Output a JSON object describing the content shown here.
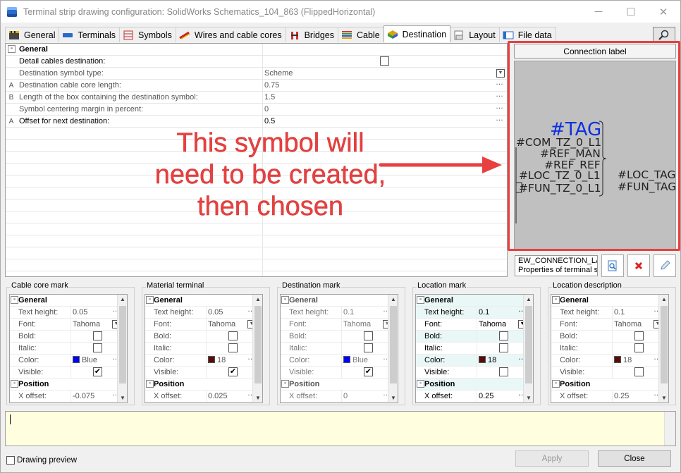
{
  "window": {
    "title": "Terminal strip drawing configuration: SolidWorks Schematics_104_863 (FlippedHorizontal)",
    "controls": {
      "minimize": "─",
      "maximize": "☐",
      "close": "✕"
    }
  },
  "tabs": [
    {
      "label": "General",
      "icon": "clapperboard-icon"
    },
    {
      "label": "Terminals",
      "icon": "terminal-icon"
    },
    {
      "label": "Symbols",
      "icon": "symbols-icon"
    },
    {
      "label": "Wires and cable cores",
      "icon": "wire-icon"
    },
    {
      "label": "Bridges",
      "icon": "bridge-icon"
    },
    {
      "label": "Cable",
      "icon": "cable-icon"
    },
    {
      "label": "Destination",
      "icon": "destination-icon",
      "active": true
    },
    {
      "label": "Layout",
      "icon": "layout-icon"
    },
    {
      "label": "File data",
      "icon": "file-data-icon"
    }
  ],
  "properties": {
    "section": "General",
    "rows": [
      {
        "flag": "",
        "name": "Detail cables destination:",
        "value": "",
        "type": "checkbox"
      },
      {
        "flag": "",
        "name": "Destination symbol type:",
        "value": "Scheme",
        "type": "dropdown"
      },
      {
        "flag": "A",
        "name": "Destination cable core length:",
        "value": "0.75",
        "type": "edit"
      },
      {
        "flag": "B",
        "name": "Length of the box containing the destination symbol:",
        "value": "1.5",
        "type": "edit"
      },
      {
        "flag": "",
        "name": "Symbol centering margin in percent:",
        "value": "0",
        "type": "edit"
      },
      {
        "flag": "A",
        "name": "Offset for next destination:",
        "value": "0.5",
        "type": "edit"
      }
    ]
  },
  "connection_label": {
    "header": "Connection label",
    "preview": {
      "tag": "#TAG",
      "lines": [
        "#COM_TZ_0_L1",
        "#REF_MAN",
        "#REF_REF",
        "#LOC_TZ_0_L1",
        "#FUN_TZ_0_L1"
      ],
      "right_lines": [
        "#LOC_TAG",
        "#FUN_TAG"
      ]
    },
    "list": [
      "EW_CONNECTION_LA",
      "Properties of terminal stri"
    ]
  },
  "annotation": "This symbol will need to be created, then chosen",
  "groups": [
    {
      "title": "Cable core mark",
      "text_height": "0.05",
      "font": "Tahoma",
      "color": "Blue",
      "color_hex": "#0000ff",
      "bold": false,
      "italic": false,
      "visible": true,
      "x_offset": "-0.075",
      "highlight": false
    },
    {
      "title": "Material terminal",
      "text_height": "0.05",
      "font": "Tahoma",
      "color": "18",
      "color_hex": "#5a0a0a",
      "bold": false,
      "italic": false,
      "visible": true,
      "x_offset": "0.025",
      "highlight": false
    },
    {
      "title": "Destination mark",
      "text_height": "0.1",
      "font": "Tahoma",
      "color": "Blue",
      "color_hex": "#0000ff",
      "bold": false,
      "italic": false,
      "visible": true,
      "x_offset": "0",
      "highlight": false,
      "greyed": true
    },
    {
      "title": "Location mark",
      "text_height": "0.1",
      "font": "Tahoma",
      "color": "18",
      "color_hex": "#5a0a0a",
      "bold": false,
      "italic": false,
      "visible": false,
      "x_offset": "0.25",
      "highlight": true
    },
    {
      "title": "Location description",
      "text_height": "0.1",
      "font": "Tahoma",
      "color": "18",
      "color_hex": "#5a0a0a",
      "bold": false,
      "italic": false,
      "visible": false,
      "x_offset": "0.25",
      "highlight": false
    }
  ],
  "group_labels": {
    "general": "General",
    "text_height": "Text height:",
    "font": "Font:",
    "bold": "Bold:",
    "italic": "Italic:",
    "color": "Color:",
    "visible": "Visible:",
    "position": "Position",
    "x_offset": "X offset:"
  },
  "footer": {
    "drawing_preview": "Drawing preview",
    "apply": "Apply",
    "close": "Close"
  }
}
